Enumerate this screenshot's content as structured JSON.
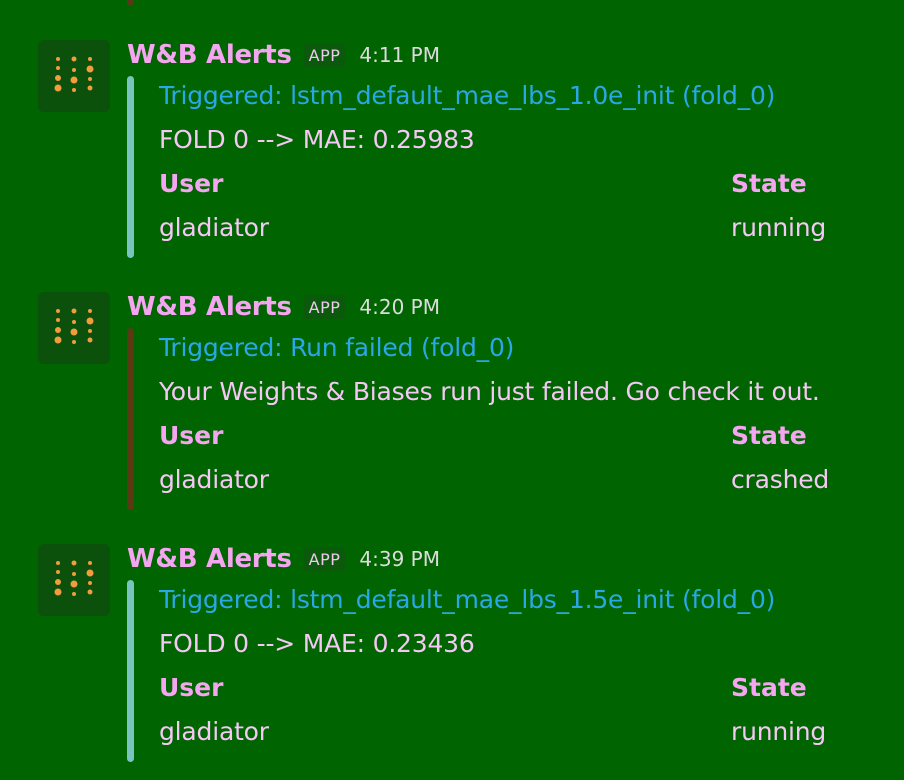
{
  "colors": {
    "background": "#006400",
    "sender": "#f5a6f0",
    "link": "#2aa7e6",
    "text": "#f5c8f5",
    "bar_normal": "#7ac4c0",
    "bar_failed": "#5b3a13",
    "avatar_dots": "#f29b3f"
  },
  "messages": [
    {
      "sender": "W&B Alerts",
      "badge": "APP",
      "time": "4:11 PM",
      "avatar_icon": "wandb-logo-icon",
      "bar_color": "#7ac4c0",
      "title": "Triggered: lstm_default_mae_lbs_1.0e_init (fold_0)",
      "text": "FOLD 0 --> MAE: 0.25983",
      "fields": {
        "user_label": "User",
        "user_value": "gladiator",
        "state_label": "State",
        "state_value": "running"
      }
    },
    {
      "sender": "W&B Alerts",
      "badge": "APP",
      "time": "4:20 PM",
      "avatar_icon": "wandb-logo-icon",
      "bar_color": "#5b3a13",
      "title": "Triggered: Run failed (fold_0)",
      "text": "Your Weights & Biases run just failed. Go check it out.",
      "fields": {
        "user_label": "User",
        "user_value": "gladiator",
        "state_label": "State",
        "state_value": "crashed"
      }
    },
    {
      "sender": "W&B Alerts",
      "badge": "APP",
      "time": "4:39 PM",
      "avatar_icon": "wandb-logo-icon",
      "bar_color": "#7ac4c0",
      "title": "Triggered: lstm_default_mae_lbs_1.5e_init (fold_0)",
      "text": "FOLD 0 --> MAE: 0.23436",
      "fields": {
        "user_label": "User",
        "user_value": "gladiator",
        "state_label": "State",
        "state_value": "running"
      }
    }
  ]
}
